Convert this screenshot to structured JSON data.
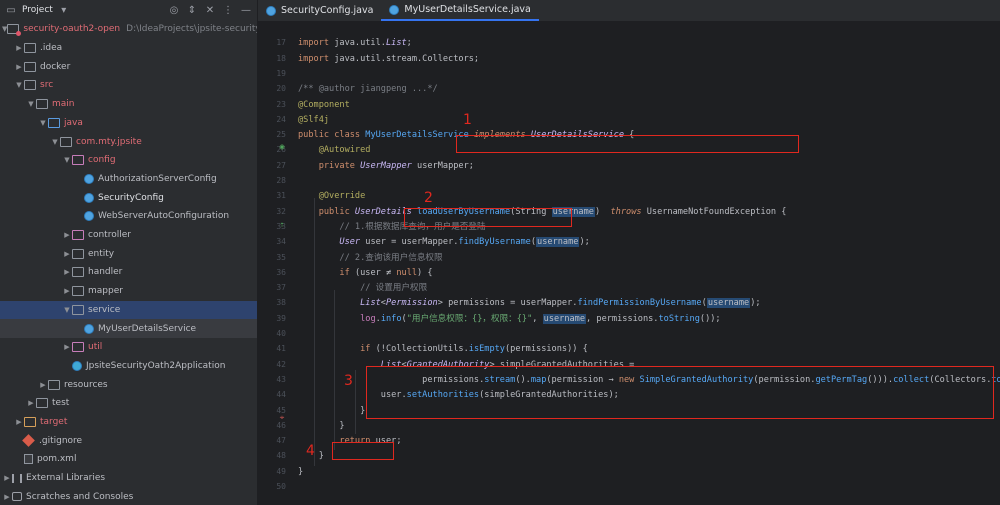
{
  "project_panel": {
    "title": "Project",
    "tree": [
      {
        "label": "security-oauth2-open",
        "hint": "D:\\IdeaProjects\\jpsite-security-oauth",
        "indent": 0,
        "arrow": "down",
        "icon": "folder-module",
        "style": "red"
      },
      {
        "label": ".idea",
        "indent": 1,
        "arrow": "right",
        "icon": "folder"
      },
      {
        "label": "docker",
        "indent": 1,
        "arrow": "right",
        "icon": "folder"
      },
      {
        "label": "src",
        "indent": 1,
        "arrow": "down",
        "icon": "folder",
        "style": "red"
      },
      {
        "label": "main",
        "indent": 2,
        "arrow": "down",
        "icon": "folder",
        "style": "red"
      },
      {
        "label": "java",
        "indent": 3,
        "arrow": "down",
        "icon": "folder-blue",
        "style": "red"
      },
      {
        "label": "com.mty.jpsite",
        "indent": 4,
        "arrow": "down",
        "icon": "folder",
        "style": "red"
      },
      {
        "label": "config",
        "indent": 5,
        "arrow": "down",
        "icon": "folder-dot",
        "style": "red"
      },
      {
        "label": "AuthorizationServerConfig",
        "indent": 6,
        "arrow": "",
        "icon": "class"
      },
      {
        "label": "SecurityConfig",
        "indent": 6,
        "arrow": "",
        "icon": "class",
        "style": "bold"
      },
      {
        "label": "WebServerAutoConfiguration",
        "indent": 6,
        "arrow": "",
        "icon": "class"
      },
      {
        "label": "controller",
        "indent": 5,
        "arrow": "right",
        "icon": "folder-dot"
      },
      {
        "label": "entity",
        "indent": 5,
        "arrow": "right",
        "icon": "folder"
      },
      {
        "label": "handler",
        "indent": 5,
        "arrow": "right",
        "icon": "folder"
      },
      {
        "label": "mapper",
        "indent": 5,
        "arrow": "right",
        "icon": "folder"
      },
      {
        "label": "service",
        "indent": 5,
        "arrow": "down",
        "icon": "folder",
        "state": "selected"
      },
      {
        "label": "MyUserDetailsService",
        "indent": 6,
        "arrow": "",
        "icon": "class",
        "state": "hover"
      },
      {
        "label": "util",
        "indent": 5,
        "arrow": "right",
        "icon": "folder-dot",
        "style": "red"
      },
      {
        "label": "JpsiteSecurityOath2Application",
        "indent": 5,
        "arrow": "",
        "icon": "spring-class"
      },
      {
        "label": "resources",
        "indent": 3,
        "arrow": "right",
        "icon": "folder"
      },
      {
        "label": "test",
        "indent": 2,
        "arrow": "right",
        "icon": "folder"
      },
      {
        "label": "target",
        "indent": 1,
        "arrow": "right",
        "icon": "folder-orange",
        "style": "red"
      },
      {
        "label": ".gitignore",
        "indent": 1,
        "arrow": "",
        "icon": "git"
      },
      {
        "label": "pom.xml",
        "indent": 1,
        "arrow": "",
        "icon": "file"
      },
      {
        "label": "External Libraries",
        "indent": 0,
        "arrow": "right",
        "icon": "bars"
      },
      {
        "label": "Scratches and Consoles",
        "indent": 0,
        "arrow": "right",
        "icon": "console"
      }
    ]
  },
  "tabs": [
    {
      "label": "SecurityConfig.java",
      "active": false
    },
    {
      "label": "MyUserDetailsService.java",
      "active": true
    }
  ],
  "editor": {
    "lines": [
      {
        "n": "",
        "segs": []
      },
      {
        "n": "17",
        "segs": [
          [
            "kw",
            "import "
          ],
          [
            "",
            "java.util."
          ],
          [
            "ty",
            "List"
          ],
          [
            "",
            ";"
          ]
        ]
      },
      {
        "n": "18",
        "segs": [
          [
            "kw",
            "import "
          ],
          [
            "",
            "java.util.stream.Collectors;"
          ]
        ]
      },
      {
        "n": "19",
        "segs": []
      },
      {
        "n": "20",
        "segs": [
          [
            "cm",
            "/** @author jiangpeng ...*/"
          ]
        ]
      },
      {
        "n": "23",
        "segs": [
          [
            "an",
            "@Component"
          ]
        ]
      },
      {
        "n": "24",
        "segs": [
          [
            "an",
            "@Slf4j"
          ]
        ]
      },
      {
        "n": "25",
        "segs": [
          [
            "kw",
            "public class "
          ],
          [
            "cn",
            "MyUserDetailsService"
          ],
          [
            "",
            " "
          ],
          [
            "kw",
            "implements "
          ],
          [
            "ty",
            "UserDetailsService"
          ],
          [
            "",
            " {"
          ]
        ]
      },
      {
        "n": "26",
        "segs": [
          [
            "",
            "    "
          ],
          [
            "an",
            "@Autowired"
          ]
        ]
      },
      {
        "n": "27",
        "segs": [
          [
            "",
            "    "
          ],
          [
            "kw",
            "private "
          ],
          [
            "ty",
            "UserMapper "
          ],
          [
            "",
            "userMapper;"
          ]
        ]
      },
      {
        "n": "28",
        "segs": []
      },
      {
        "n": "31",
        "segs": [
          [
            "",
            "    "
          ],
          [
            "an",
            "@Override"
          ]
        ]
      },
      {
        "n": "32",
        "segs": [
          [
            "",
            "    "
          ],
          [
            "kw",
            "public "
          ],
          [
            "ty",
            "UserDetails "
          ],
          [
            "cn",
            "loadUserByUsername"
          ],
          [
            "",
            "(String "
          ],
          [
            "pa",
            "username"
          ],
          [
            "",
            ")  "
          ],
          [
            "kw",
            "throws "
          ],
          [
            "",
            "UsernameNotFoundException {"
          ]
        ]
      },
      {
        "n": "33",
        "segs": [
          [
            "",
            "        "
          ],
          [
            "cm",
            "// 1.根据数据库查询，用户是否登陆"
          ]
        ]
      },
      {
        "n": "34",
        "segs": [
          [
            "",
            "        "
          ],
          [
            "ty",
            "User "
          ],
          [
            "",
            "user = userMapper."
          ],
          [
            "cn",
            "findByUsername"
          ],
          [
            "",
            "("
          ],
          [
            "pa",
            "username"
          ],
          [
            "",
            ");"
          ]
        ]
      },
      {
        "n": "35",
        "segs": [
          [
            "",
            "        "
          ],
          [
            "cm",
            "// 2.查询该用户信息权限"
          ]
        ]
      },
      {
        "n": "36",
        "segs": [
          [
            "",
            "        "
          ],
          [
            "kw",
            "if "
          ],
          [
            "",
            "(user ≠ "
          ],
          [
            "kw",
            "null"
          ],
          [
            "",
            ") {"
          ]
        ]
      },
      {
        "n": "37",
        "segs": [
          [
            "",
            "            "
          ],
          [
            "cm",
            "// 设置用户权限"
          ]
        ]
      },
      {
        "n": "38",
        "segs": [
          [
            "",
            "            "
          ],
          [
            "ty",
            "List"
          ],
          [
            "",
            "<"
          ],
          [
            "ty",
            "Permission"
          ],
          [
            "",
            "> permissions = userMapper."
          ],
          [
            "cn",
            "findPermissionByUsername"
          ],
          [
            "",
            "("
          ],
          [
            "pa",
            "username"
          ],
          [
            "",
            ");"
          ]
        ]
      },
      {
        "n": "39",
        "segs": [
          [
            "",
            "            "
          ],
          [
            "fl",
            "log"
          ],
          [
            "",
            "."
          ],
          [
            "cn",
            "info"
          ],
          [
            "",
            "("
          ],
          [
            "str",
            "\"用户信息权限：{}，权限：{}\""
          ],
          [
            "",
            ", "
          ],
          [
            "pa",
            "username"
          ],
          [
            "",
            ", permissions."
          ],
          [
            "cn",
            "toString"
          ],
          [
            "",
            "());"
          ]
        ]
      },
      {
        "n": "40",
        "segs": []
      },
      {
        "n": "41",
        "segs": [
          [
            "",
            "            "
          ],
          [
            "kw",
            "if "
          ],
          [
            "",
            "(!CollectionUtils."
          ],
          [
            "cn",
            "isEmpty"
          ],
          [
            "",
            "(permissions)) {"
          ]
        ]
      },
      {
        "n": "42",
        "segs": [
          [
            "",
            "                "
          ],
          [
            "ty",
            "List"
          ],
          [
            "",
            "<"
          ],
          [
            "ty",
            "GrantedAuthority"
          ],
          [
            "",
            "> simpleGrantedAuthorities ="
          ]
        ]
      },
      {
        "n": "43",
        "segs": [
          [
            "",
            "                        permissions."
          ],
          [
            "cn",
            "stream"
          ],
          [
            "",
            "()."
          ],
          [
            "cn",
            "map"
          ],
          [
            "",
            "(permission → "
          ],
          [
            "kw",
            "new "
          ],
          [
            "cn",
            "SimpleGrantedAuthority"
          ],
          [
            "",
            "(permission."
          ],
          [
            "cn",
            "getPermTag"
          ],
          [
            "",
            "()))."
          ],
          [
            "cn",
            "collect"
          ],
          [
            "",
            "(Collectors."
          ],
          [
            "cn",
            "toList"
          ],
          [
            "",
            "());"
          ]
        ]
      },
      {
        "n": "44",
        "segs": [
          [
            "",
            "                user."
          ],
          [
            "cn",
            "setAuthorities"
          ],
          [
            "",
            "(simpleGrantedAuthorities);"
          ]
        ]
      },
      {
        "n": "45",
        "segs": [
          [
            "",
            "            }"
          ]
        ]
      },
      {
        "n": "46",
        "segs": [
          [
            "",
            "        }"
          ]
        ]
      },
      {
        "n": "47",
        "segs": [
          [
            "",
            "        "
          ],
          [
            "kw",
            "return "
          ],
          [
            "",
            "user;"
          ]
        ]
      },
      {
        "n": "48",
        "segs": [
          [
            "",
            "    }"
          ]
        ]
      },
      {
        "n": "49",
        "segs": [
          [
            "",
            "}"
          ]
        ]
      },
      {
        "n": "50",
        "segs": []
      }
    ],
    "annotations": [
      "1",
      "2",
      "3",
      "4"
    ]
  },
  "colors": {
    "accent": "#3574f0",
    "annotation": "#e0281f",
    "background": "#1e1f22",
    "panel": "#2b2d30"
  }
}
